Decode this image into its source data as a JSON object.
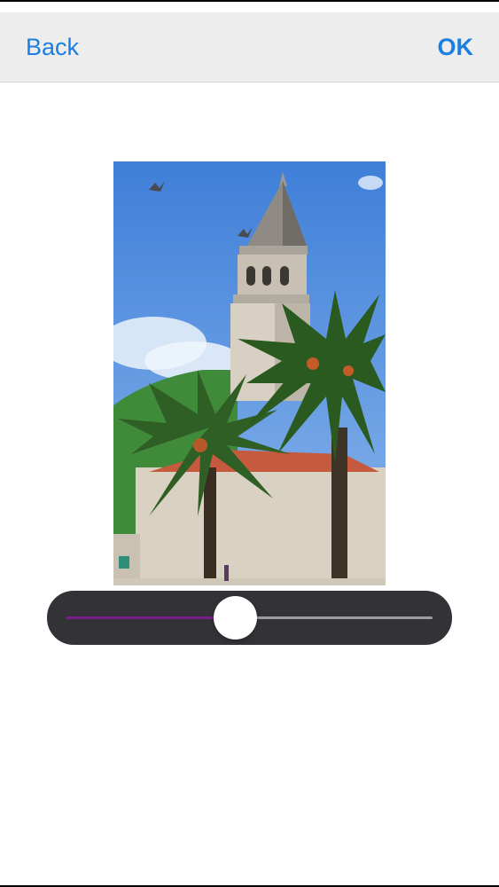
{
  "nav": {
    "back_label": "Back",
    "ok_label": "OK"
  },
  "photo": {
    "description_icon": "church-bell-tower-with-palms-photo"
  },
  "slider": {
    "value_fraction": 0.46,
    "fill_color": "#7b1a8c",
    "track_color": "#9d9d9d",
    "panel_color": "#333236"
  },
  "colors": {
    "accent": "#1a7fe0",
    "nav_background": "#ededed"
  }
}
